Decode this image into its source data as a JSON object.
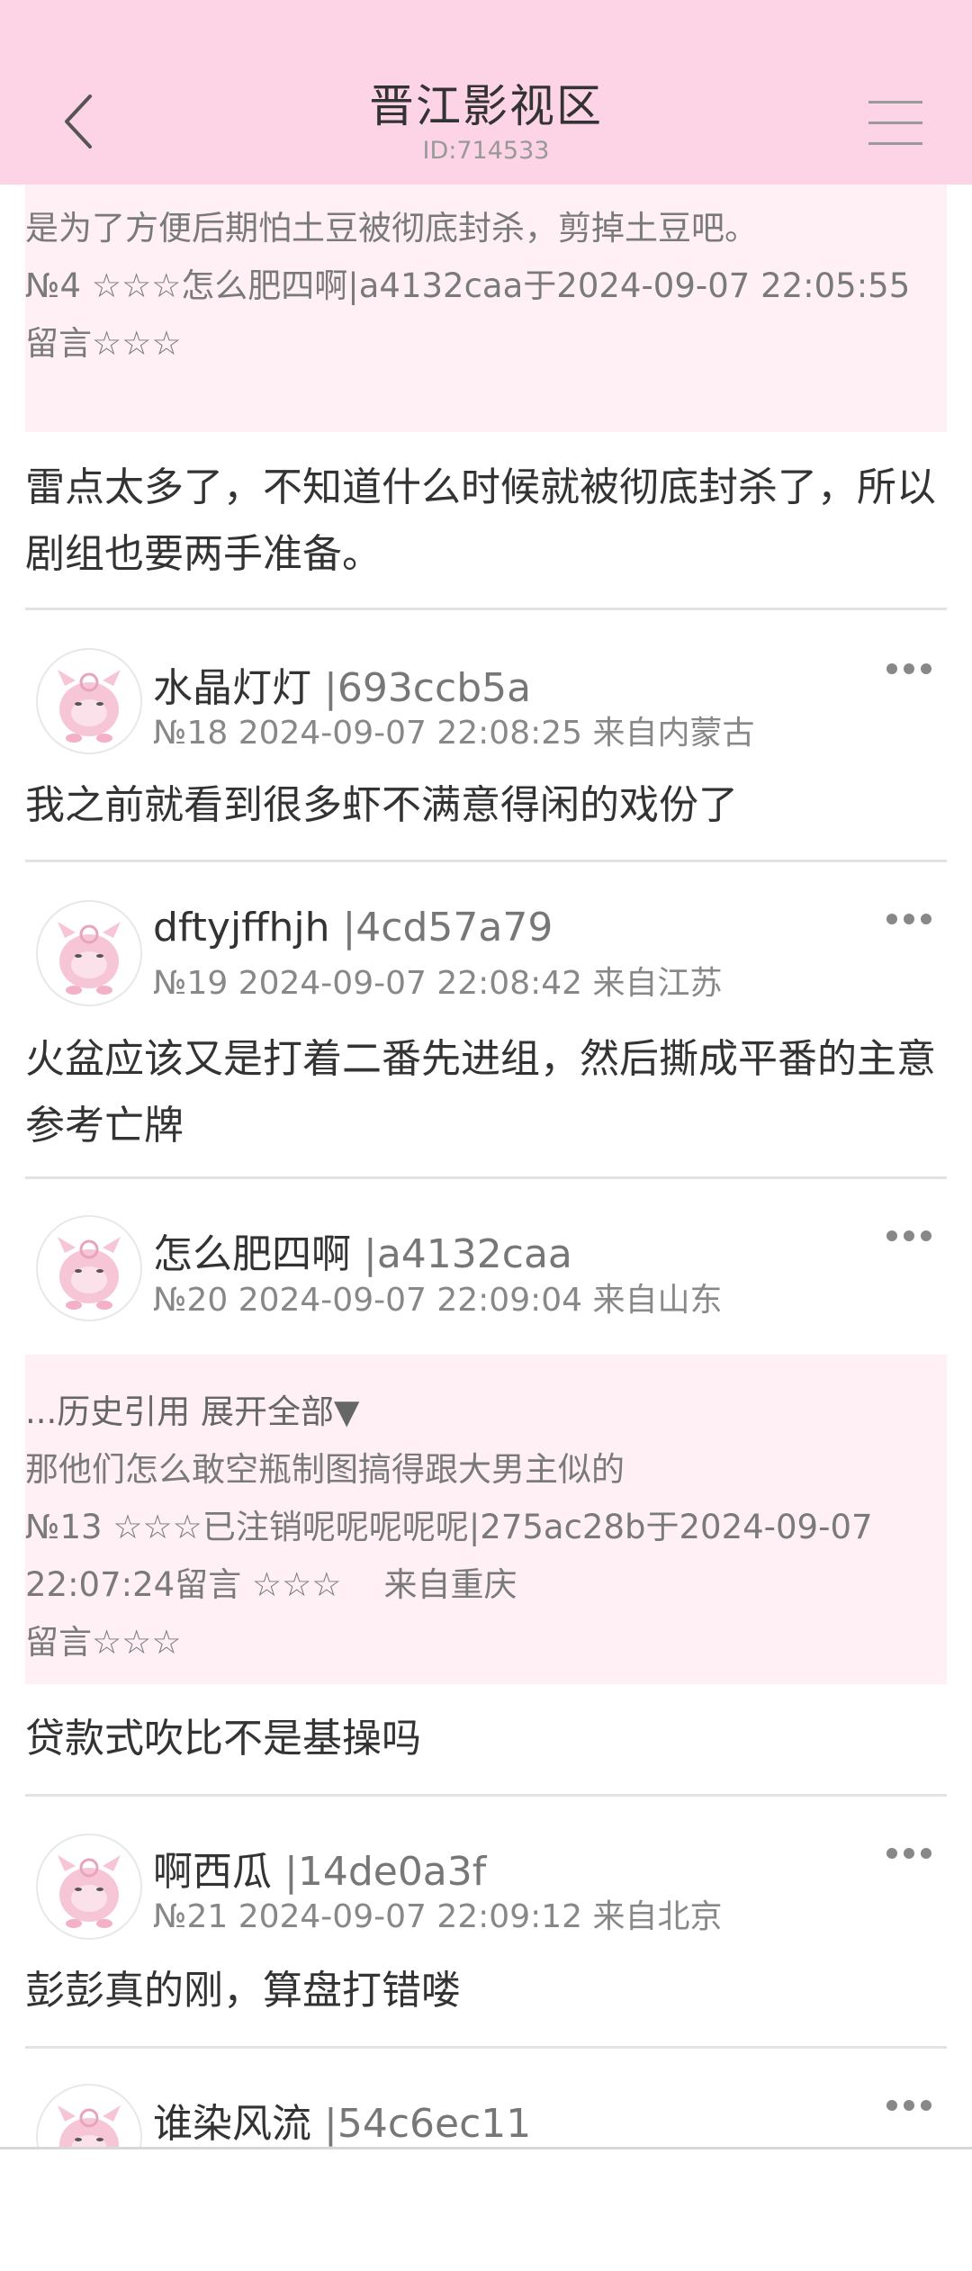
{
  "header": {
    "title": "晋江影视区",
    "id_text": "ID:714533"
  },
  "quote_top": {
    "line1": "是为了方便后期怕土豆被彻底封杀，剪掉土豆吧。",
    "line2": "№4 ☆☆☆怎么肥四啊|a4132caa于2024-09-07 22:05:55",
    "line3": "留言☆☆☆"
  },
  "top_post_text": "雷点太多了，不知道什么时候就被彻底封杀了，所以剧组也要两手准备。",
  "posts": [
    {
      "name": "水晶灯灯",
      "uid": "|693ccb5a",
      "meta": "№18 2024-09-07 22:08:25 来自内蒙古",
      "text": "我之前就看到很多虾不满意得闲的戏份了"
    },
    {
      "name": "dftyjffhjh",
      "uid": "|4cd57a79",
      "meta": "№19 2024-09-07 22:08:42 来自江苏",
      "text": "火盆应该又是打着二番先进组，然后撕成平番的主意参考亡牌"
    },
    {
      "name": "怎么肥四啊",
      "uid": "|a4132caa",
      "meta": "№20 2024-09-07 22:09:04 来自山东",
      "quote": {
        "line1": "...历史引用 展开全部▼",
        "line2": "那他们怎么敢空瓶制图搞得跟大男主似的",
        "line3": "№13 ☆☆☆已注销呢呢呢呢呢|275ac28b于2024-09-07",
        "line4": "22:07:24留言 ☆☆☆    来自重庆",
        "line5": "留言☆☆☆"
      },
      "text": "贷款式吹比不是基操吗"
    },
    {
      "name": "啊西瓜",
      "uid": "|14de0a3f",
      "meta": "№21 2024-09-07 22:09:12 来自北京",
      "text": "彭彭真的刚，算盘打错喽"
    },
    {
      "name": "谁染风流",
      "uid": "|54c6ec11"
    }
  ],
  "colors": {
    "header_bg": "#fdd3e6",
    "quote_bg": "#fff0f6"
  },
  "icons": {
    "back": "chevron-left-icon",
    "menu": "hamburger-menu-icon",
    "more": "more-dots-icon",
    "avatar": "pink-creature-avatar-icon"
  }
}
